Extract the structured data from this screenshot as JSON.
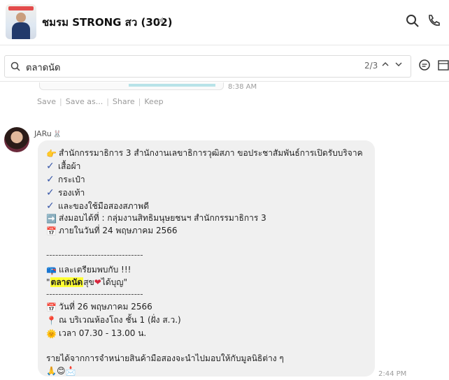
{
  "header": {
    "group_name": "ชมรม STRONG สว (302)",
    "mute_icon": "speaker-muted-icon",
    "actions": [
      "search-icon",
      "phone-icon"
    ]
  },
  "search": {
    "query": "ตลาดนัด",
    "result_count": "2/3",
    "up_label": "^",
    "down_label": "v",
    "tools": [
      "chat-bubble-icon",
      "calendar-icon"
    ]
  },
  "previous_message": {
    "time": "8:38 AM",
    "actions": [
      "Save",
      "Save as...",
      "Share",
      "Keep"
    ]
  },
  "message": {
    "sender": "JARu",
    "sender_emoji": "🐰",
    "time": "2:44 PM",
    "lines": {
      "l1_icon": "👉",
      "l1": "สำนักกรรมาธิการ 3 สำนักงานเลขาธิการวุฒิสภา ขอประชาสัมพันธ์การเปิดรับบริจาค",
      "l2": "เสื้อผ้า",
      "l3": "กระเป๋า",
      "l4": "รองเท้า",
      "l5": "และของใช้มือสองสภาพดี",
      "l6_icon": "➡️",
      "l6": "ส่งมอบได้ที่ : กลุ่มงานสิทธิมนุษยชนฯ สำนักกรรมาธิการ 3",
      "l7_icon": "📅",
      "l7": "ภายในวันที่ 24 พฤษภาคม 2566",
      "divider1": "--------------------------------",
      "l8_icon": "📪",
      "l8": "และเตรียมพบกับ !!!",
      "l9_open": "\"",
      "l9_highlight": "ตลาดนัด",
      "l9_mid": "สุข",
      "l9_heart": "❤",
      "l9_end": "ได้บุญ\"",
      "divider2": "--------------------------------",
      "l10_icon": "📅",
      "l10": "วันที่ 26 พฤษภาคม 2566",
      "l11_icon": "📍",
      "l11": "ณ บริเวณห้องโถง ชั้น 1 (ฝั่ง ส.ว.)",
      "l12_icon": "🌞",
      "l12": "เวลา 07.30 - 13.00 น.",
      "l13": "รายได้จากการจำหน่ายสินค้ามือสองจะนำไปมอบให้กับมูลนิธิต่าง ๆ",
      "l14": "🙏😊📩"
    }
  }
}
